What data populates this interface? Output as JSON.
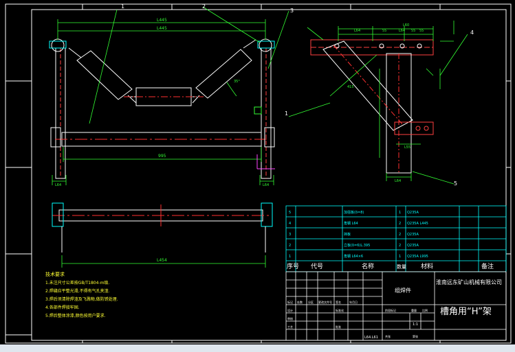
{
  "drawing": {
    "title_cn": "槽角用“H”架",
    "company_cn": "淮南远东矿山机械有限公司",
    "part_type": "组焊件",
    "scale": "1:1"
  },
  "front_view": {
    "callouts": [
      "1",
      "2",
      "3"
    ],
    "dim_top_outer": "L445",
    "dim_top_inner": "L445",
    "dim_bottom": "995",
    "dim_left_foot": "L64",
    "dim_right_foot": "L64",
    "angle": "35°"
  },
  "side_view": {
    "callout_right": "4",
    "callout_left": "1",
    "callout_bottom": "5",
    "dim_top_a": "L64",
    "dim_top_b": "55",
    "dim_top_c": "L64",
    "dim_top_d": "55",
    "dim_top_e": "L60",
    "dim_top_f": "55",
    "dim_incline": "415",
    "dim_bottom": "L64",
    "dim_slot": "L55"
  },
  "plan_view": {
    "dim_bottom": "L454"
  },
  "notes": {
    "title": "技术要求",
    "lines": [
      "1.未注尺寸公差按GB/T1804-m级.",
      "2.焊缝应平整光滑,不得有气孔夹渣.",
      "3.焊后须清除焊渣及飞溅物,做防锈处理.",
      "4.各部件焊接牢固.",
      "5.焊后整体涂漆,颜色按用户要求."
    ]
  },
  "bom": {
    "header": [
      "序号",
      "代号",
      "名称",
      "数量",
      "材料",
      "备注"
    ],
    "rows": [
      {
        "no": "5",
        "code": "",
        "name": "加强板(δ=8)",
        "qty": "1",
        "material": "Q235A",
        "note": ""
      },
      {
        "no": "4",
        "code": "",
        "name": "角钢 L64",
        "qty": "2",
        "material": "Q235A L445",
        "note": ""
      },
      {
        "no": "3",
        "code": "",
        "name": "挡板",
        "qty": "2",
        "material": "Q235A",
        "note": ""
      },
      {
        "no": "2",
        "code": "",
        "name": "立板(δ=6)L.395",
        "qty": "2",
        "material": "Q235A",
        "note": ""
      },
      {
        "no": "1",
        "code": "",
        "name": "角钢 L64×6",
        "qty": "1",
        "material": "Q235A L995",
        "note": ""
      }
    ]
  },
  "title_block": {
    "labels": [
      "标记",
      "处数",
      "分区",
      "更改文件号",
      "签名",
      "年月日",
      "设计",
      "标准化",
      "审核",
      "工艺",
      "批准",
      "阶段标记",
      "重量",
      "比例",
      "共张",
      "第张"
    ],
    "date_cell": "L64.L61"
  },
  "colors": {
    "background": "#000000",
    "frame": "#ffffff",
    "dims": "#33ff33",
    "steel": "#ff4040",
    "center_line": "#ff3030",
    "table": "#00ffff",
    "roller": "#ffffff",
    "notes": "#ffff33",
    "accent": "#ff44ff"
  }
}
